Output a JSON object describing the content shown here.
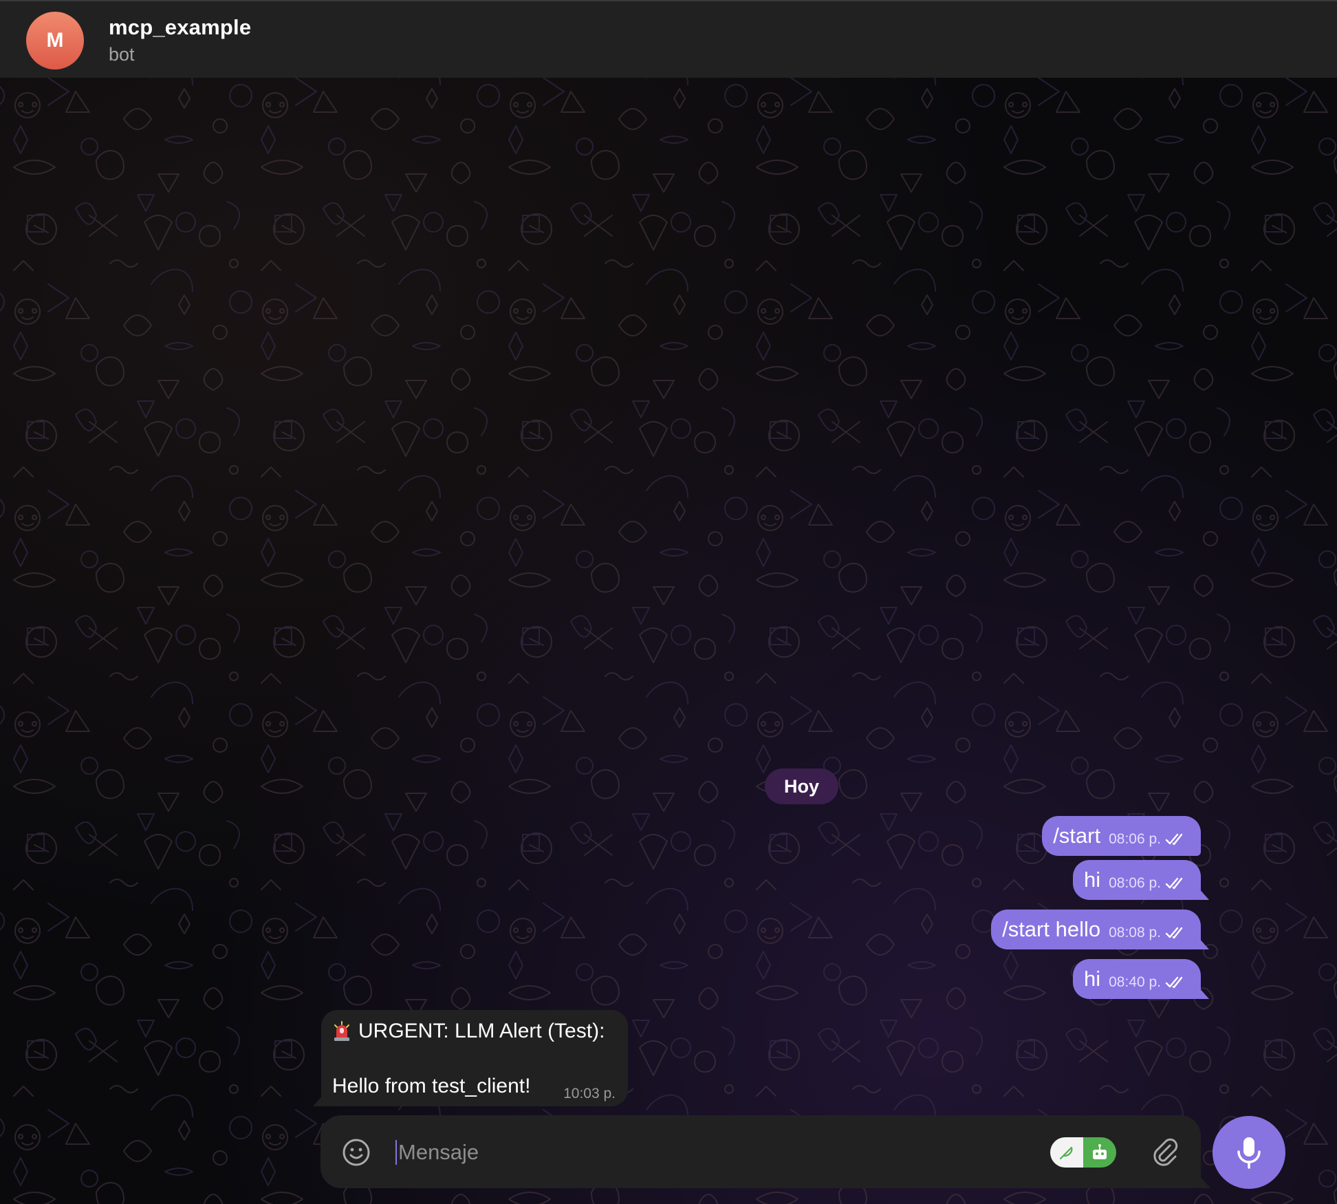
{
  "header": {
    "avatar_letter": "M",
    "title": "mcp_example",
    "subtitle": "bot"
  },
  "date_separator": "Hoy",
  "outgoing_messages": [
    {
      "text": "/start",
      "time": "08:06 p.",
      "status": "read"
    },
    {
      "text": "hi",
      "time": "08:06 p.",
      "status": "read"
    },
    {
      "text": "/start hello",
      "time": "08:08 p.",
      "status": "read"
    },
    {
      "text": "hi",
      "time": "08:40 p.",
      "status": "read"
    }
  ],
  "incoming_message": {
    "icon": "police-siren-icon",
    "line1": "URGENT: LLM Alert (Test):",
    "line2": "Hello from test_client!",
    "time": "10:03 p."
  },
  "composer": {
    "placeholder": "Mensaje",
    "value": ""
  },
  "colors": {
    "accent": "#8774e1",
    "header_bg": "#212121",
    "bubble_in_bg": "#212121",
    "date_pill_bg": "#3a1f4d",
    "avatar": "#e56b55",
    "bot_toggle_on": "#4fae4e"
  }
}
